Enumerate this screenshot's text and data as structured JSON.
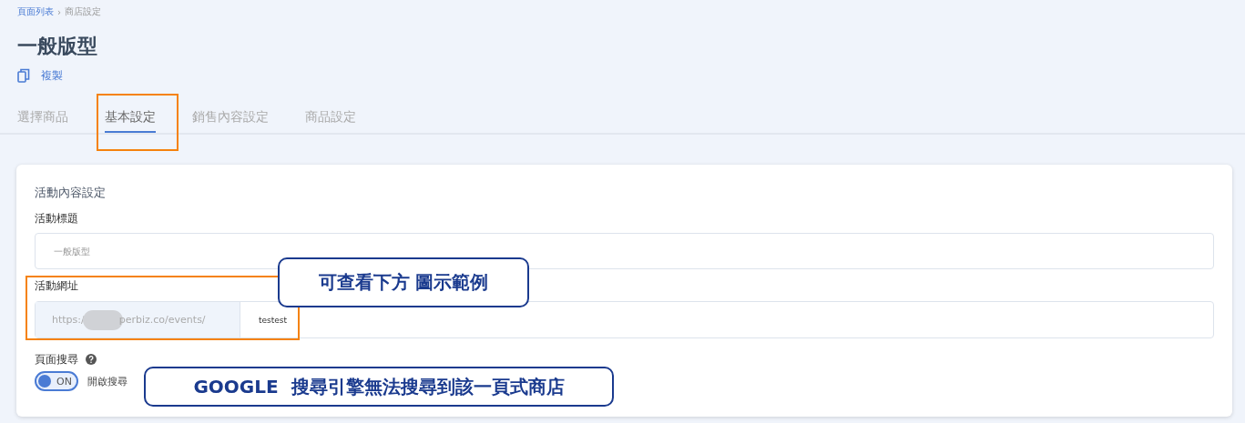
{
  "breadcrumb": [
    {
      "label": "頁面列表",
      "link": true
    },
    {
      "label": "商店設定",
      "link": false
    }
  ],
  "separator": "›",
  "page_title": "一般版型",
  "copy_action": {
    "label": "複製"
  },
  "tabs": [
    {
      "label": "選擇商品",
      "selected": false
    },
    {
      "label": "基本設定",
      "selected": true
    },
    {
      "label": "銷售內容設定",
      "selected": false
    },
    {
      "label": "商品設定",
      "selected": false
    }
  ],
  "card": {
    "title": "活動內容設定",
    "title_field": {
      "label": "活動標題",
      "placeholder": "一般版型"
    },
    "url_field": {
      "label": "活動網址",
      "prefix_start": "https:/",
      "prefix_end": "perbiz.co/events/",
      "value": "testest"
    },
    "search_setting": {
      "label": "頁面搜尋",
      "toggle": {
        "on": true,
        "text": "ON"
      },
      "toggle_label": "開啟搜尋"
    }
  },
  "annotations": [
    {
      "text": "可查看下方 圖示範例"
    },
    {
      "text": "GOOGLE  搜尋引擎無法搜尋到該一頁式商店"
    }
  ]
}
